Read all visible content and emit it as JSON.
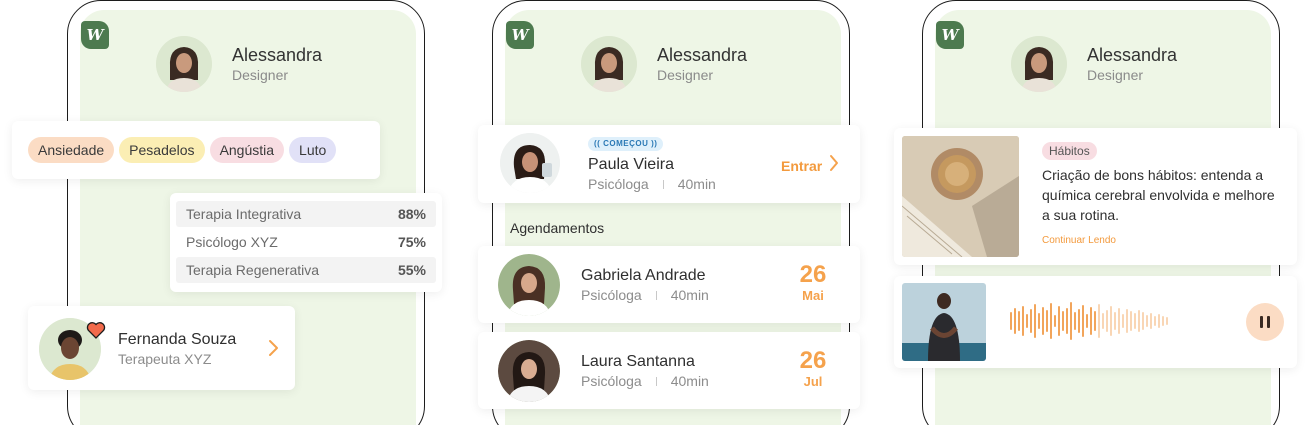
{
  "brand": {
    "logo_letter": "W",
    "accent": "#f5a24c",
    "screen_bg": "#eef6e6",
    "logo_bg": "#4d7a4f"
  },
  "profile": {
    "name": "Alessandra",
    "role": "Designer"
  },
  "screen1": {
    "tags": [
      {
        "label": "Ansiedade",
        "color": "#fbdcc4"
      },
      {
        "label": "Pesadelos",
        "color": "#fbeeb4"
      },
      {
        "label": "Angústia",
        "color": "#f8dde2"
      },
      {
        "label": "Luto",
        "color": "#e1e1f7"
      }
    ],
    "matches": [
      {
        "label": "Terapia Integrativa",
        "value": "88%"
      },
      {
        "label": "Psicólogo XYZ",
        "value": "75%"
      },
      {
        "label": "Terapia Regenerativa",
        "value": "55%"
      }
    ],
    "therapist": {
      "name": "Fernanda Souza",
      "role": "Terapeuta XYZ",
      "badge_icon": "heart-icon"
    }
  },
  "screen2": {
    "live": {
      "badge": "COMEÇOU",
      "name": "Paula Vieira",
      "role": "Psicóloga",
      "duration": "40min",
      "action": "Entrar"
    },
    "section_title": "Agendamentos",
    "appointments": [
      {
        "name": "Gabriela Andrade",
        "role": "Psicóloga",
        "duration": "40min",
        "day": "26",
        "month": "Mai"
      },
      {
        "name": "Laura Santanna",
        "role": "Psicóloga",
        "duration": "40min",
        "day": "26",
        "month": "Jul"
      }
    ]
  },
  "screen3": {
    "article": {
      "tag": "Hábitos",
      "title": "Criação de bons hábitos: entenda a química cerebral envolvida e melhore a sua rotina.",
      "link": "Continuar Lendo"
    },
    "audio": {
      "state": "playing",
      "control_icon": "pause-icon"
    }
  }
}
